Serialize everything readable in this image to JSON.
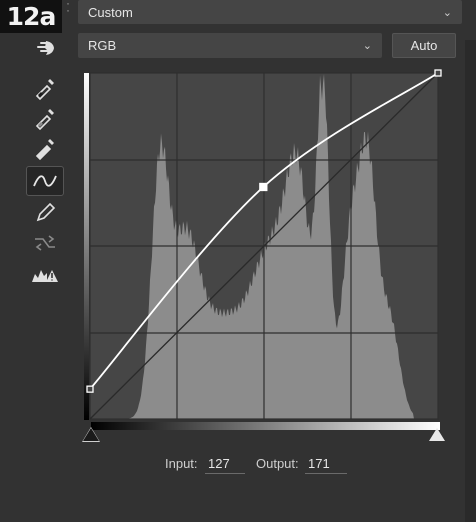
{
  "figure_label": "12a",
  "preset": {
    "value": "Custom"
  },
  "channel": {
    "value": "RGB"
  },
  "auto_label": "Auto",
  "tools": [
    "on-image-adjust-icon",
    "black-point-eyedropper-icon",
    "gray-point-eyedropper-icon",
    "white-point-eyedropper-icon",
    "curve-point-icon",
    "pencil-draw-icon",
    "smooth-curve-icon",
    "clipping-warning-icon"
  ],
  "io": {
    "input_label": "Input:",
    "input_value": "127",
    "output_label": "Output:",
    "output_value": "171"
  },
  "curve": {
    "points": [
      [
        0,
        22
      ],
      [
        127,
        171
      ],
      [
        255,
        255
      ]
    ],
    "selected_point": 1
  },
  "colors": {
    "background": "#323232",
    "graph_bg": "#464646",
    "histogram": "#8a8a8a",
    "curve": "#ffffff",
    "grid": "#2a2a2a"
  }
}
